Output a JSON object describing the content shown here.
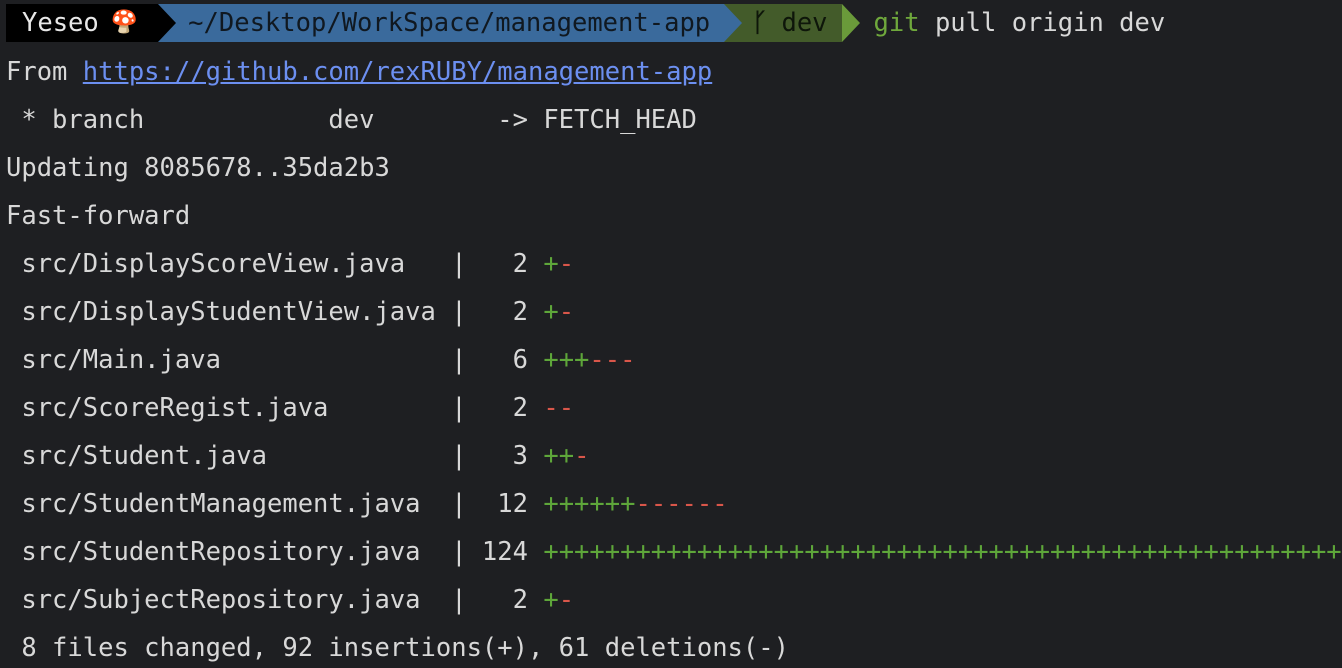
{
  "prompt": {
    "user": "Yeseo",
    "user_emoji": "🍄",
    "path": "~/Desktop/WorkSpace/management-app",
    "branch_icon": "git-branch-icon",
    "branch": "dev",
    "command_git": "git",
    "command_rest": " pull origin dev"
  },
  "output": {
    "from_label": "From ",
    "url": "https://github.com/rexRUBY/management-app",
    "branch_line": " * branch            dev        -> FETCH_HEAD",
    "updating": "Updating 8085678..35da2b3",
    "fast_forward": "Fast-forward",
    "files": [
      {
        "prefix": " src/DisplayScoreView.java   |   2 ",
        "plus": "+",
        "minus": "-"
      },
      {
        "prefix": " src/DisplayStudentView.java |   2 ",
        "plus": "+",
        "minus": "-"
      },
      {
        "prefix": " src/Main.java               |   6 ",
        "plus": "+++",
        "minus": "---"
      },
      {
        "prefix": " src/ScoreRegist.java        |   2 ",
        "plus": "",
        "minus": "--"
      },
      {
        "prefix": " src/Student.java            |   3 ",
        "plus": "++",
        "minus": "-"
      },
      {
        "prefix": " src/StudentManagement.java  |  12 ",
        "plus": "++++++",
        "minus": "------"
      },
      {
        "prefix": " src/StudentRepository.java  | 124 ",
        "plus": "++++++++++++++++++++++++++++++++++++++++++++++++++++++++",
        "minus": ""
      },
      {
        "prefix": " src/SubjectRepository.java  |   2 ",
        "plus": "+",
        "minus": "-"
      }
    ],
    "summary": " 8 files changed, 92 insertions(+), 61 deletions(-)"
  },
  "colors": {
    "background": "#1e1f22",
    "user_segment": "#000000",
    "path_segment": "#3a6a9c",
    "branch_segment": "#435b2a",
    "insertions": "#5ea63a",
    "deletions": "#d9564a",
    "link": "#6c8ff0"
  }
}
